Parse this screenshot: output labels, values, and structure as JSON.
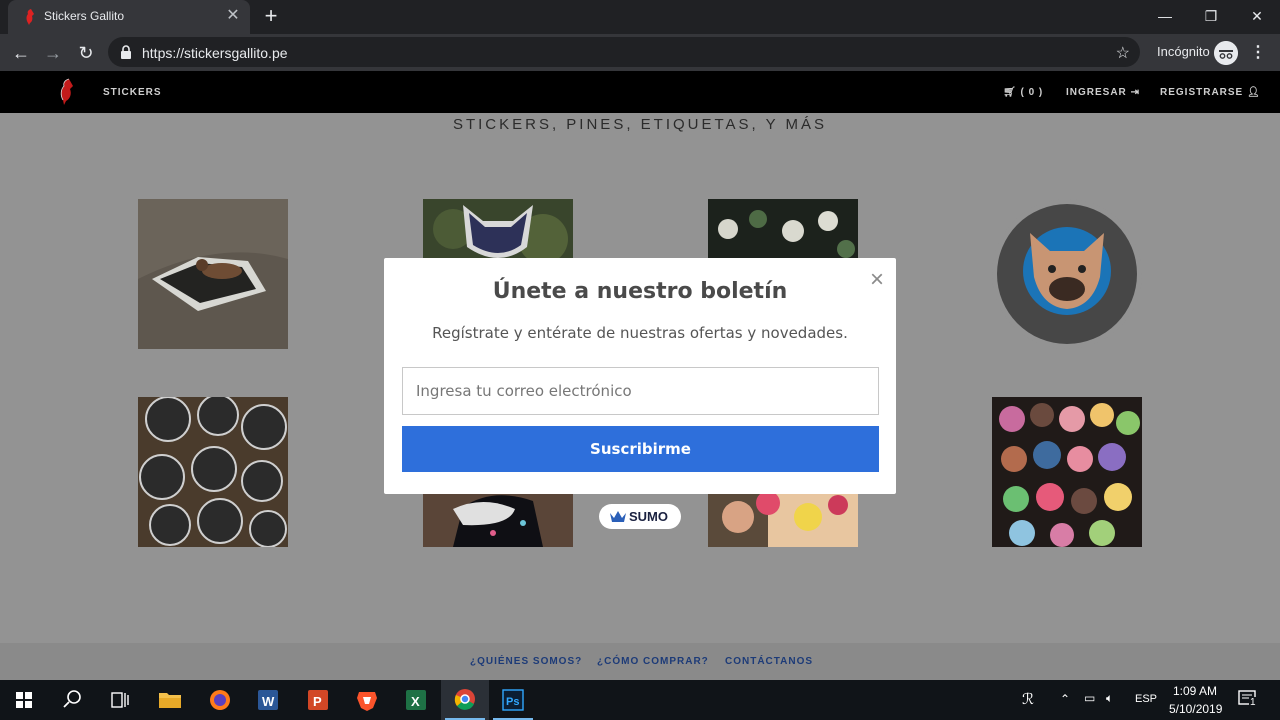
{
  "browser": {
    "tab_title": "Stickers Gallito",
    "tab_close": "✕",
    "new_tab": "+",
    "url": "https://stickersgallito.pe",
    "profile_label": "Incógnito"
  },
  "site": {
    "nav": {
      "stickers": "STICKERS",
      "cart": "( 0 )",
      "ingresar": "INGRESAR",
      "registrarse": "REGISTRARSE"
    },
    "heading": "STICKERS, PINES, ETIQUETAS, Y MÁS",
    "footer": {
      "quienes": "¿QUIÉNES SOMOS?",
      "como": "¿CÓMO COMPRAR?",
      "contactanos": "CONTÁCTANOS"
    }
  },
  "modal": {
    "close": "×",
    "title": "Únete a nuestro boletín",
    "subtitle": "Regístrate y entérate de nuestras ofertas y novedades.",
    "email_placeholder": "Ingresa tu correo electrónico",
    "email_value": "",
    "button_label": "Suscribirme",
    "badge": "SUMO"
  },
  "taskbar": {
    "time": "1:09 AM",
    "date": "5/10/2019",
    "language": "ESP",
    "notifications": "1"
  },
  "colors": {
    "accent": "#2e6fdb",
    "footer_link": "#1d3b78",
    "overlay": "#939393"
  }
}
